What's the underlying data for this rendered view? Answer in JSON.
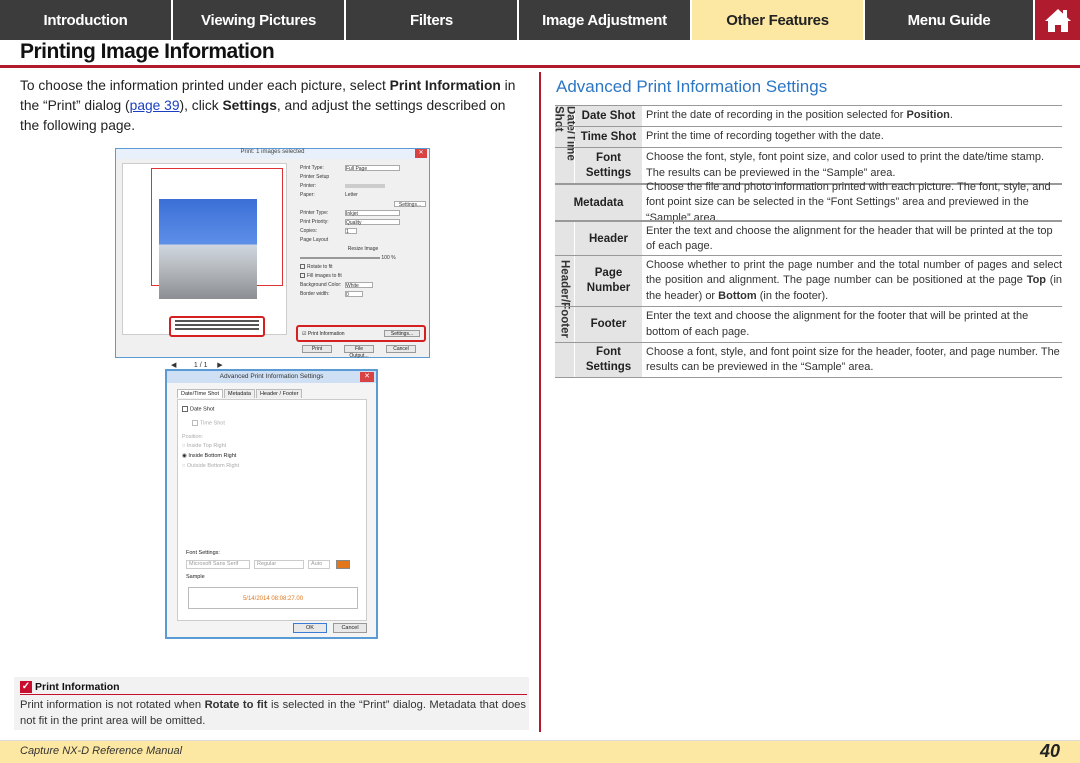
{
  "nav": {
    "tabs": [
      {
        "label": "Introduction"
      },
      {
        "label": "Viewing Pictures"
      },
      {
        "label": "Filters"
      },
      {
        "label": "Image Adjustment"
      },
      {
        "label": "Other Features"
      },
      {
        "label": "Menu Guide"
      }
    ],
    "active_tab": "Other Features",
    "home_icon": "home-icon",
    "colors": {
      "tab_bg": "#3c3c3c",
      "active_bg": "#fde8a3",
      "accent": "#b01c2e"
    }
  },
  "page": {
    "title": "Printing Image Information",
    "intro": {
      "t1": "To choose the information printed under each picture, select ",
      "b1": "Print Information",
      "t2": " in the “Print” dialog (",
      "link": "page 39",
      "t3": "), click ",
      "b2": "Settings",
      "t4": ", and adjust the settings described on the following page."
    }
  },
  "print_dialog": {
    "title": "Print: 1 images selected",
    "labels": {
      "print_type": "Print Type:",
      "print_type_value": "Full Page",
      "printer_setup": "Printer Setup",
      "printer": "Printer:",
      "paper": "Paper:",
      "paper_value": "Letter",
      "settings_btn": "Settings...",
      "printer_type": "Printer Type:",
      "printer_type_value": "Inkjet",
      "print_priority": "Print Priority:",
      "print_priority_value": "Quality",
      "copies": "Copies:",
      "copies_value": "1",
      "page_layout": "Page Layout",
      "resize_image": "Resize Image",
      "resize_value": "100 %",
      "rotate_to_fit": "Rotate to fit",
      "fill_images": "Fill images to fit",
      "background_color": "Background Color:",
      "background_value": "White",
      "border_width": "Border width:",
      "border_value": "0",
      "print_information": "Print Information",
      "settings2": "Settings...",
      "print_btn": "Print",
      "file_output_btn": "File Output...",
      "cancel_btn": "Cancel",
      "page_nav": "1 / 1"
    }
  },
  "advanced_dialog": {
    "title": "Advanced Print Information Settings",
    "tabs": [
      "Date/Time Shot",
      "Metadata",
      "Header / Footer"
    ],
    "date_shot": "Date Shot",
    "time_shot": "Time Shot",
    "position_label": "Position:",
    "positions": [
      "Inside Top Right",
      "Inside Bottom Right",
      "Outside Bottom Right"
    ],
    "font_settings": "Font Settings:",
    "font_name": "Microsoft Sans Serif",
    "font_style": "Regular",
    "font_size": "Auto",
    "sample_label": "Sample",
    "sample_value": "5/14/2014 08:08:27.00",
    "ok": "OK",
    "cancel": "Cancel"
  },
  "note": {
    "title": "Print Information",
    "t1": "Print information is not rotated when ",
    "b1": "Rotate to fit",
    "t2": " is selected in the “Print” dialog. Metadata that does not fit in the print area will be omitted."
  },
  "right": {
    "heading": "Advanced Print Information Settings",
    "groups": {
      "date_time": "Date/Time Shot",
      "header_footer": "Header/Footer"
    },
    "rows": [
      {
        "key": "Date Shot",
        "t1": "Print the date of recording in the position selected for ",
        "b1": "Position",
        "t2": "."
      },
      {
        "key": "Time Shot",
        "t1": "Print the time of recording together with the date."
      },
      {
        "key": "Font Settings",
        "t1": "Choose the font, style, font point size, and color used to print the date/time stamp. The results can be previewed in the “Sample” area."
      },
      {
        "key": "Metadata",
        "t1": "Choose the file and photo information printed with each picture. The font, style, and font point size can be selected in the “Font Settings” area and previewed in the “Sample” area."
      },
      {
        "key": "Header",
        "t1": "Enter the text and choose the alignment for the header that will be printed at the top of each page."
      },
      {
        "key": "Page Number",
        "t1": "Choose whether to print the page number and the total number of pages and select the position and alignment. The page number can be positioned at the page ",
        "b1": "Top",
        "t2": " (in the header) or ",
        "b2": "Bottom",
        "t3": " (in the footer)."
      },
      {
        "key": "Footer",
        "t1": "Enter the text and choose the alignment for the footer that will be printed at the bottom of each page."
      },
      {
        "key": "Font Settings",
        "t1": "Choose a font, style, and font point size for the header, footer, and page number. The results can be previewed in the “Sample” area."
      }
    ]
  },
  "footer": {
    "manual": "Capture NX-D Reference Manual",
    "page_number": "40"
  }
}
